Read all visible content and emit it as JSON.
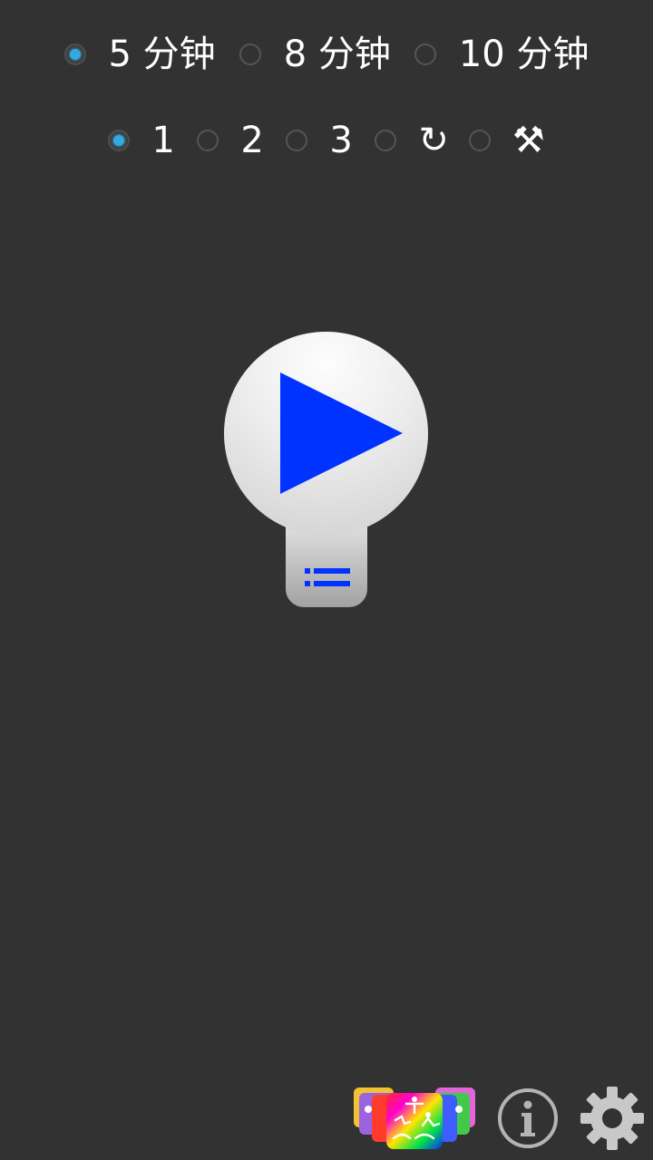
{
  "durations": {
    "options": [
      {
        "label": "5 分钟",
        "checked": true
      },
      {
        "label": "8 分钟",
        "checked": false
      },
      {
        "label": "10 分钟",
        "checked": false
      }
    ]
  },
  "sets": {
    "options": [
      {
        "label": "1",
        "checked": true
      },
      {
        "label": "2",
        "checked": false
      },
      {
        "label": "3",
        "checked": false
      },
      {
        "label": "↻",
        "checked": false,
        "icon": "repeat-icon"
      },
      {
        "label": "⚒",
        "checked": false,
        "icon": "hammer-pick-icon"
      }
    ]
  },
  "player": {
    "play_icon": "play-icon",
    "list_icon": "list-icon"
  },
  "bottom_bar": {
    "apps_icon": "apps-icon",
    "info_icon": "info-icon",
    "settings_icon": "gear-icon"
  },
  "colors": {
    "background": "#323232",
    "accent": "#35a9df",
    "play_blue": "#0033ff"
  }
}
